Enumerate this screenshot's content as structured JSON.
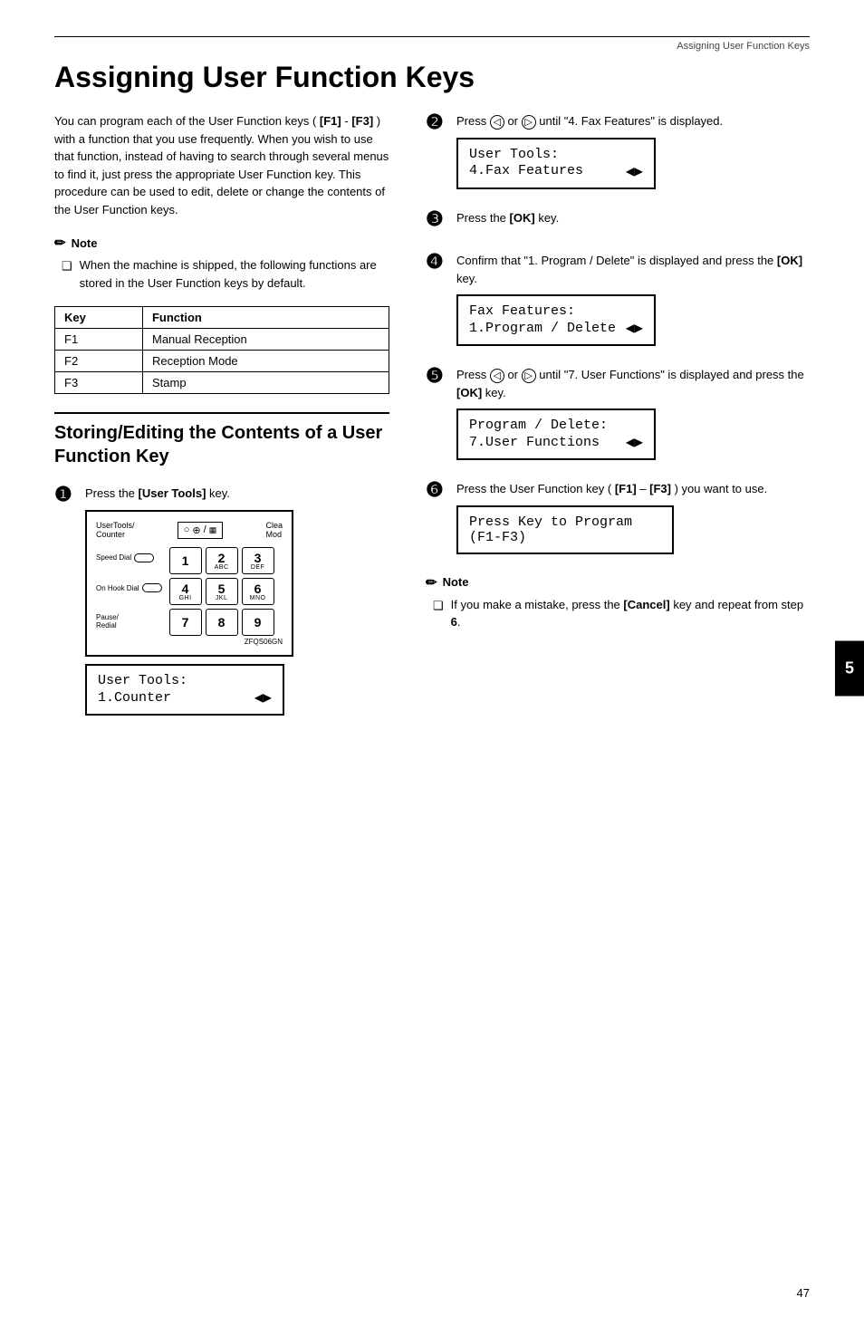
{
  "page": {
    "header": "Assigning User Function Keys",
    "title": "Assigning User Function Keys",
    "page_number": "47",
    "chapter_number": "5"
  },
  "intro": {
    "text": "You can program each of the User Function keys ( [F1] - [F3] ) with a function that you use frequently. When you wish to use that function, instead of having to search through several menus to find it, just press the appropriate User Function key. This procedure can be used to edit, delete or change the contents of the User Function keys."
  },
  "note": {
    "title": "Note",
    "item": "When the machine is shipped, the following functions are stored in the User Function keys by default."
  },
  "default_table": {
    "headers": [
      "Key",
      "Function"
    ],
    "rows": [
      [
        "F1",
        "Manual Reception"
      ],
      [
        "F2",
        "Reception Mode"
      ],
      [
        "F3",
        "Stamp"
      ]
    ]
  },
  "section": {
    "title": "Storing/Editing the Contents of a User Function Key"
  },
  "steps_left": [
    {
      "num": "1",
      "text": "Press the [User Tools] key.",
      "has_keypad": true,
      "lcd": {
        "line1": "User Tools:",
        "line2": "1.Counter",
        "arrow": true
      }
    }
  ],
  "steps_right": [
    {
      "num": "2",
      "text": "Press ◁ or ▷ until \"4. Fax Features\" is displayed.",
      "lcd": {
        "line1": "User Tools:",
        "line2": "4.Fax Features",
        "arrow": true
      }
    },
    {
      "num": "3",
      "text": "Press the [OK] key.",
      "lcd": null
    },
    {
      "num": "4",
      "text": "Confirm that \"1. Program / Delete\" is displayed and press the [OK] key.",
      "lcd": {
        "line1": "Fax Features:",
        "line2": "1.Program / Delete",
        "arrow": true
      }
    },
    {
      "num": "5",
      "text": "Press ◁ or ▷ until \"7. User Functions\" is displayed and press the [OK] key.",
      "lcd": {
        "line1": "Program / Delete:",
        "line2": "7.User Functions",
        "arrow": true
      }
    },
    {
      "num": "6",
      "text": "Press the User Function key ( [F1] – [F3] ) you want to use.",
      "lcd": {
        "line1": "Press Key to Program",
        "line2": "(F1-F3)",
        "arrow": false
      }
    }
  ],
  "note_right": {
    "title": "Note",
    "item": "If you make a mistake, press the [Cancel] key and repeat from step 6."
  },
  "keypad": {
    "label_top_left": "UserTools/\nCounter",
    "label_clear": "Clea\nMod",
    "label_speed_dial": "Speed Dial",
    "label_on_hook": "On Hook Dial",
    "label_pause": "Pause/\nRedial",
    "keys": [
      {
        "num": "1",
        "sub": ""
      },
      {
        "num": "2",
        "sub": "ABC"
      },
      {
        "num": "3",
        "sub": "DEF"
      },
      {
        "num": "4",
        "sub": "GHI"
      },
      {
        "num": "5",
        "sub": "JKL"
      },
      {
        "num": "6",
        "sub": "MNO"
      },
      {
        "num": "7",
        "sub": ""
      },
      {
        "num": "8",
        "sub": ""
      },
      {
        "num": "9",
        "sub": ""
      }
    ],
    "image_label": "ZFQS06GN"
  }
}
